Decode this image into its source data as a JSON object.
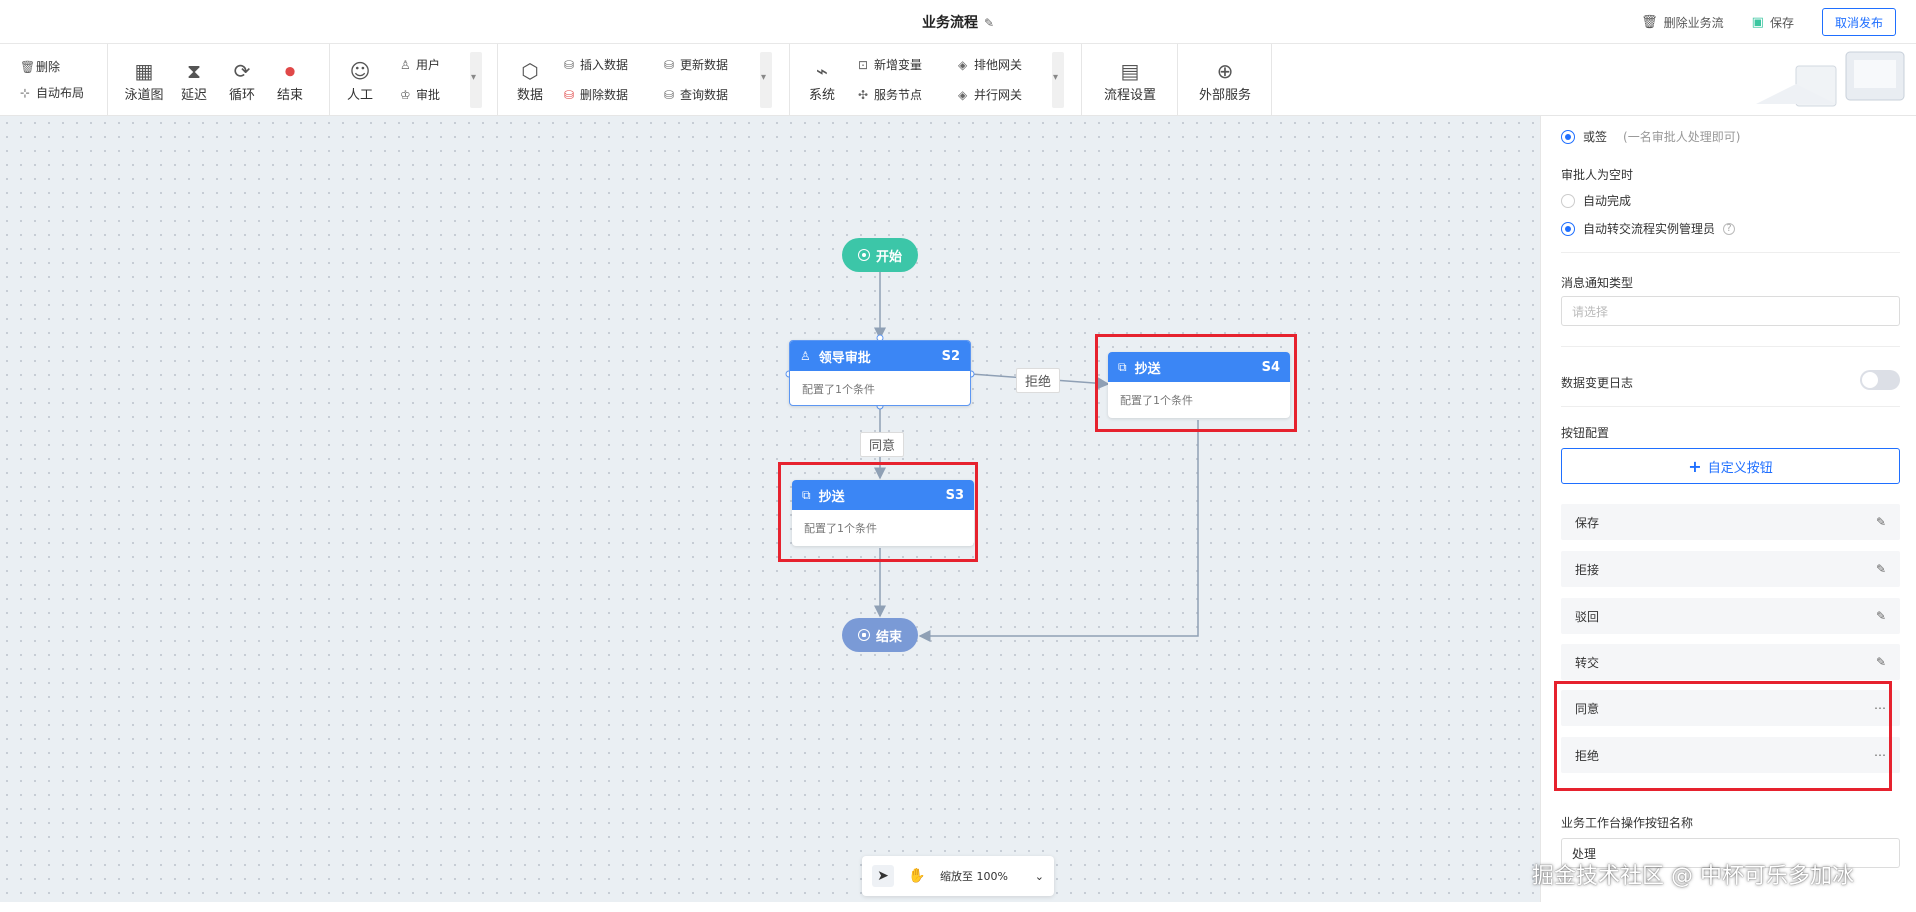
{
  "header": {
    "title": "业务流程",
    "edit_icon": "pencil-icon",
    "delete_label": "删除业务流",
    "save_label": "保存",
    "unpublish_label": "取消发布"
  },
  "toolbar": {
    "delete": "删除",
    "auto_layout": "自动布局",
    "swimlane": "泳道图",
    "delay": "延迟",
    "loop": "循环",
    "end": "结束",
    "manual": "人工",
    "user": "用户",
    "approve": "审批",
    "data": "数据",
    "insert_data": "插入数据",
    "delete_data": "删除数据",
    "update_data": "更新数据",
    "query_data": "查询数据",
    "system": "系统",
    "new_var": "新增变量",
    "service_node": "服务节点",
    "exclusive_gateway": "排他网关",
    "parallel_gateway": "并行网关",
    "process_settings": "流程设置",
    "external_service": "外部服务"
  },
  "canvas": {
    "start_label": "开始",
    "end_label": "结束",
    "nodes": [
      {
        "title": "领导审批",
        "code": "S2",
        "desc": "配置了1个条件"
      },
      {
        "title": "抄送",
        "code": "S3",
        "desc": "配置了1个条件"
      },
      {
        "title": "抄送",
        "code": "S4",
        "desc": "配置了1个条件"
      }
    ],
    "edge_reject": "拒绝",
    "edge_agree": "同意",
    "zoom_label": "缩放至 100%"
  },
  "panel": {
    "or_sign": "或签",
    "or_sign_hint": "(一名审批人处理即可)",
    "empty_approver_label": "审批人为空时",
    "auto_complete": "自动完成",
    "auto_transfer": "自动转交流程实例管理员",
    "notify_type_label": "消息通知类型",
    "notify_placeholder": "请选择",
    "data_change_log": "数据变更日志",
    "button_config": "按钮配置",
    "custom_button": "自定义按钮",
    "buttons": [
      "保存",
      "拒接",
      "驳回",
      "转交",
      "同意",
      "拒绝"
    ],
    "workbench_label": "业务工作台操作按钮名称",
    "workbench_value": "处理"
  },
  "watermark": "掘金技术社区 @ 中杯可乐多加冰",
  "colors": {
    "accent": "#1f6fff",
    "node_head": "#3b86f5",
    "start": "#3cc6a8",
    "end": "#7a9ad6",
    "highlight": "#e6222e"
  }
}
